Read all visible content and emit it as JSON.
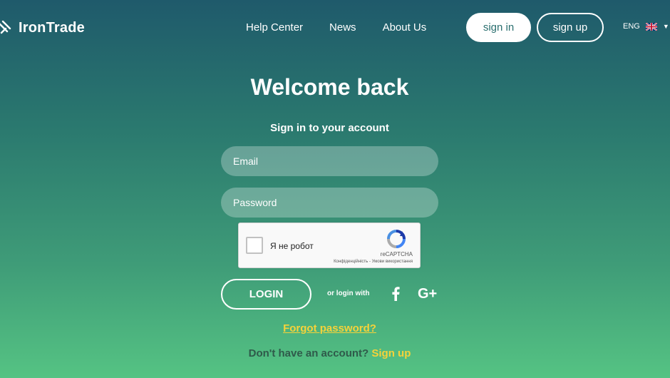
{
  "brand": {
    "name": "IronTrade"
  },
  "nav": {
    "items": [
      {
        "label": "Help Center"
      },
      {
        "label": "News"
      },
      {
        "label": "About Us"
      }
    ]
  },
  "auth": {
    "signin_label": "sign in",
    "signup_label": "sign up"
  },
  "language": {
    "code": "ENG"
  },
  "login": {
    "title": "Welcome back",
    "subtitle": "Sign in to your account",
    "email_placeholder": "Email",
    "password_placeholder": "Password",
    "login_button": "LOGIN",
    "or_login_with": "or login with",
    "forgot_password": "Forgot password?",
    "no_account_text": "Don't have an account?",
    "signup_link": "Sign up"
  },
  "captcha": {
    "label": "Я не робот",
    "brand": "reCAPTCHA",
    "privacy": "Конфіденційність",
    "separator": " - ",
    "terms": "Умови використання"
  },
  "social": {
    "google_label": "G+"
  },
  "colors": {
    "accent": "#f5d23a",
    "button_text": "#2a6f6f"
  }
}
